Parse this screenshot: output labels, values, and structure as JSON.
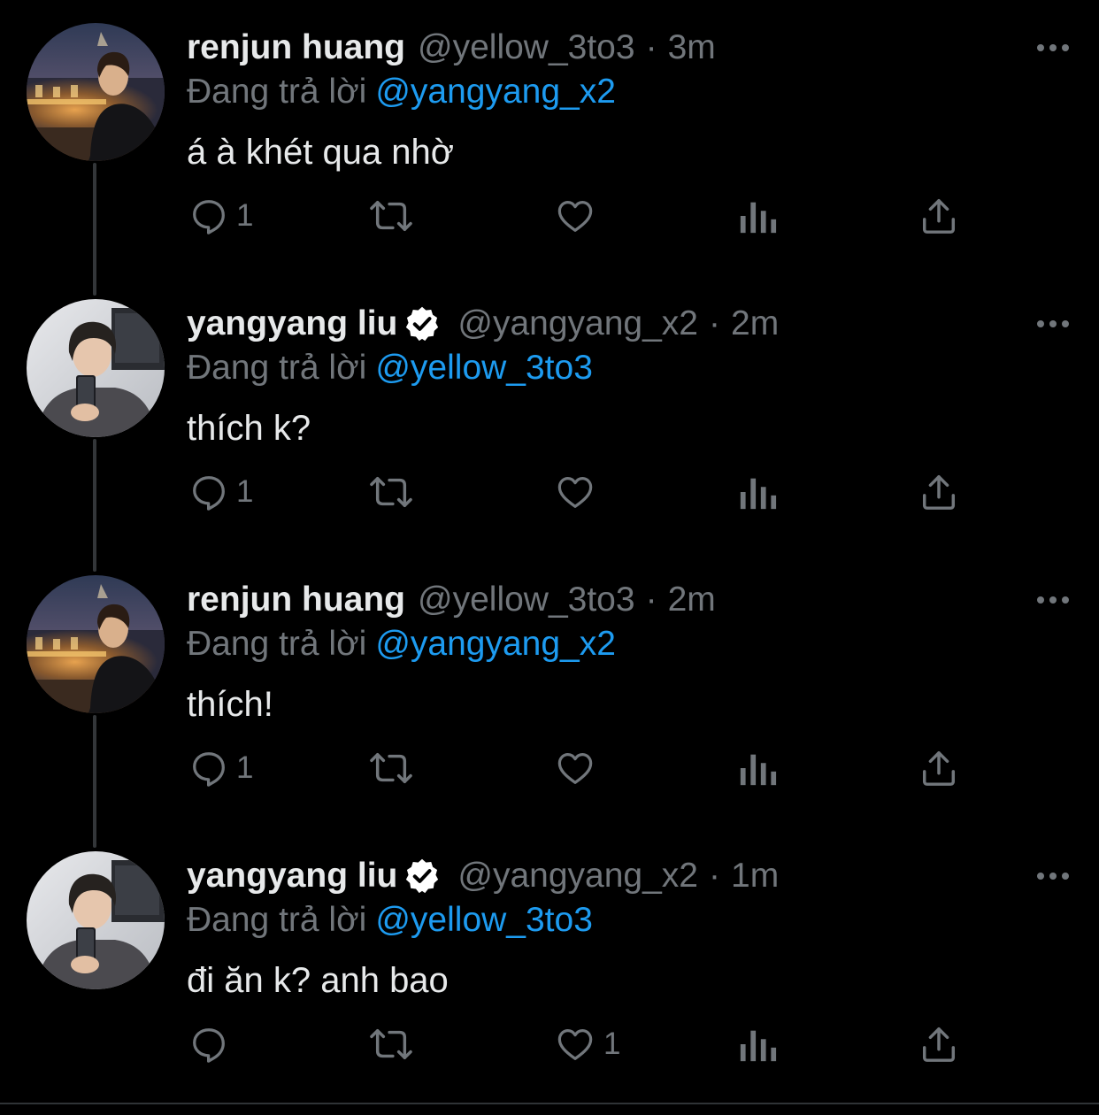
{
  "colors": {
    "background": "#000000",
    "text_primary": "#e7e9ea",
    "text_secondary": "#71767b",
    "link": "#1d9bf0",
    "thread_line": "#333639"
  },
  "icons": {
    "reply": "speech-bubble-icon",
    "retweet": "retweet-arrows-icon",
    "like": "heart-icon",
    "views": "bar-chart-icon",
    "share": "share-upload-icon",
    "more": "three-dots-icon",
    "verified": "verified-badge-icon"
  },
  "tweets": [
    {
      "name": "renjun huang",
      "verified": false,
      "handle": "@yellow_3to3",
      "separator": "·",
      "time": "3m",
      "replying_label": "Đang trả lời",
      "replying_to": "@yangyang_x2",
      "text": "á à khét qua nhờ",
      "reply_count": "1",
      "like_count": ""
    },
    {
      "name": "yangyang liu",
      "verified": true,
      "handle": "@yangyang_x2",
      "separator": "·",
      "time": "2m",
      "replying_label": "Đang trả lời",
      "replying_to": "@yellow_3to3",
      "text": "thích k?",
      "reply_count": "1",
      "like_count": ""
    },
    {
      "name": "renjun huang",
      "verified": false,
      "handle": "@yellow_3to3",
      "separator": "·",
      "time": "2m",
      "replying_label": "Đang trả lời",
      "replying_to": "@yangyang_x2",
      "text": "thích!",
      "reply_count": "1",
      "like_count": ""
    },
    {
      "name": "yangyang liu",
      "verified": true,
      "handle": "@yangyang_x2",
      "separator": "·",
      "time": "1m",
      "replying_label": "Đang trả lời",
      "replying_to": "@yellow_3to3",
      "text": "đi ăn k? anh bao",
      "reply_count": "",
      "like_count": "1"
    }
  ]
}
